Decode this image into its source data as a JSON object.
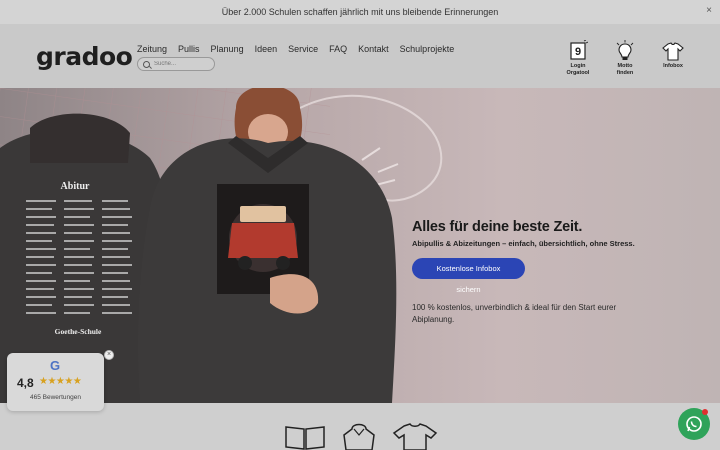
{
  "announcement": {
    "text": "Über 2.000 Schulen schaffen jährlich mit uns bleibende Erinnerungen",
    "close": "×"
  },
  "header": {
    "logo": "gradoo",
    "nav": [
      "Zeitung",
      "Pullis",
      "Planung",
      "Ideen",
      "Service",
      "FAQ",
      "Kontakt",
      "Schulprojekte"
    ],
    "search_placeholder": "Suche...",
    "icons": [
      {
        "name": "login-icon",
        "line1": "Login",
        "line2": "Orgatool",
        "glyph": "9"
      },
      {
        "name": "lightbulb-icon",
        "line1": "Motto",
        "line2": "finden"
      },
      {
        "name": "tshirt-icon",
        "line1": "Infobox",
        "line2": ""
      }
    ]
  },
  "hero": {
    "title": "Alles für deine beste Zeit.",
    "subtitle": "Abipullis & Abizeitungen – einfach, übersichtlich, ohne Stress.",
    "cta": "Kostenlose Infobox sichern",
    "note": "100 % kostenlos, unverbindlich & ideal für den Start eurer Abiplanung.",
    "hoodie_back_title": "Abitur",
    "hoodie_back_school": "Goethe-Schule"
  },
  "review": {
    "logo": "G",
    "score": "4,8",
    "stars": "★★★★★",
    "count": "465 Bewertungen",
    "close": "×"
  },
  "colors": {
    "accent": "#2b45b5",
    "whatsapp": "#2fa35a",
    "star": "#d8a11f"
  }
}
